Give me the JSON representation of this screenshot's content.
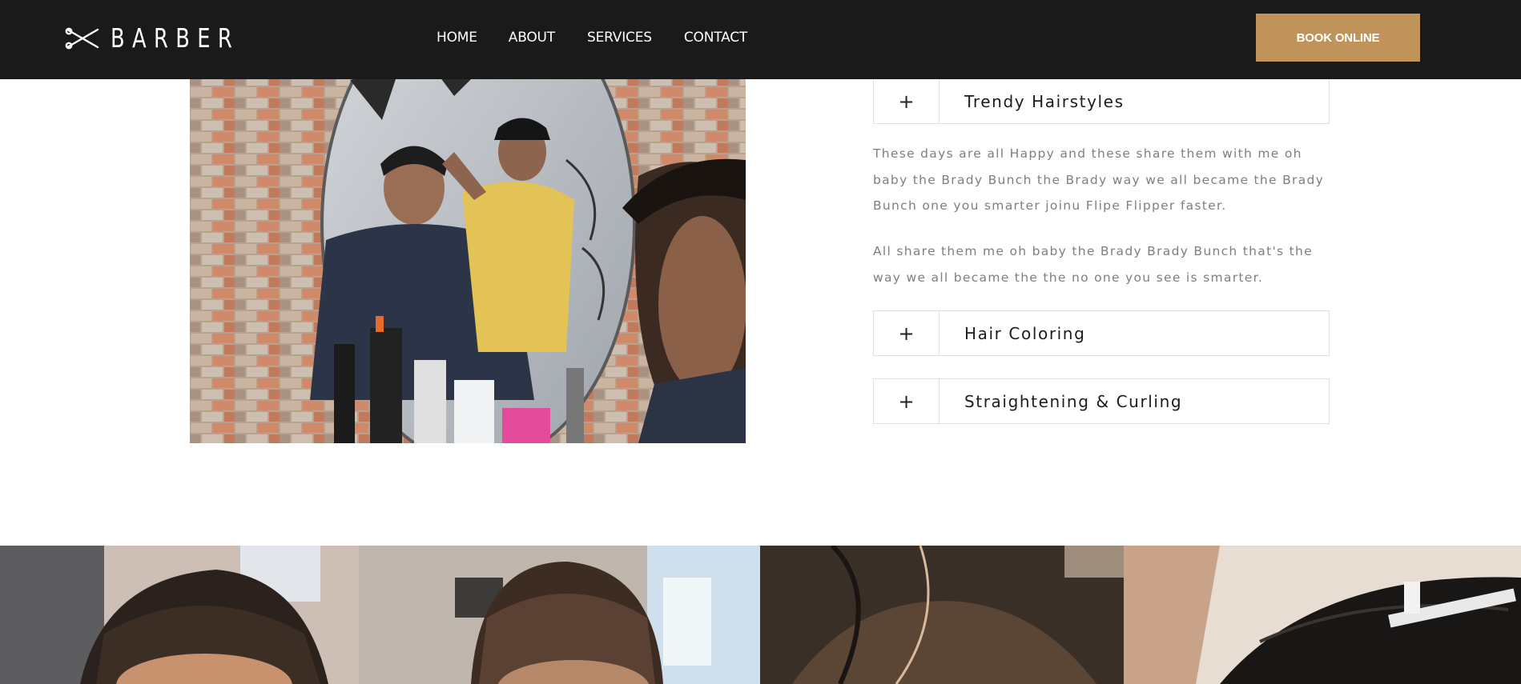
{
  "header": {
    "logo_text": "BARBER",
    "logo_icon": "scissors-icon",
    "nav": [
      {
        "label": "HOME"
      },
      {
        "label": "ABOUT"
      },
      {
        "label": "SERVICES"
      },
      {
        "label": "CONTACT"
      }
    ],
    "cta_label": "BOOK ONLINE"
  },
  "colors": {
    "header_bg": "#1a1a1a",
    "accent": "#c0935a",
    "body_text": "#7f7f7f",
    "heading_text": "#1c1c1c",
    "border": "#e1e1e1"
  },
  "accordion": {
    "items": [
      {
        "toggle": "+",
        "title": "Trendy Hairstyles",
        "expanded": true,
        "paragraphs": [
          "These days are all Happy and these share them with me oh baby the Brady Bunch the Brady way we all became the Brady Bunch one you smarter joinu Flipe Flipper faster.",
          "All share them me oh baby the Brady Brady Bunch that's the way we all became the the no one you see is smarter."
        ]
      },
      {
        "toggle": "+",
        "title": "Hair Coloring",
        "expanded": false
      },
      {
        "toggle": "+",
        "title": "Straightening & Curling",
        "expanded": false
      }
    ]
  }
}
